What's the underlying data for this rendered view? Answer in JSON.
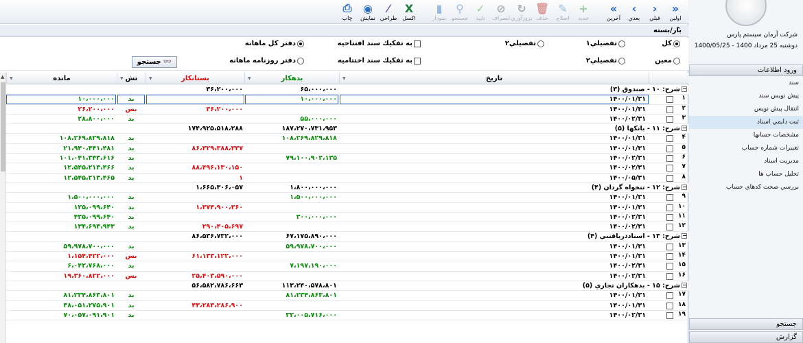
{
  "toolbar": {
    "buttons": [
      {
        "label": "اولين",
        "icon": "double-chevron-right-icon",
        "enabled": true
      },
      {
        "label": "قبلي",
        "icon": "chevron-right-icon",
        "enabled": true
      },
      {
        "label": "بعدي",
        "icon": "chevron-left-icon",
        "enabled": true
      },
      {
        "label": "آخرين",
        "icon": "double-chevron-left-icon",
        "enabled": true
      },
      {
        "label": "جديد",
        "icon": "plus-icon",
        "enabled": false
      },
      {
        "label": "اصلاح",
        "icon": "pencil-icon",
        "enabled": false
      },
      {
        "label": "حذف",
        "icon": "trash-icon",
        "enabled": false
      },
      {
        "label": "بروزآوري",
        "icon": "refresh-icon",
        "enabled": false
      },
      {
        "label": "انصراف",
        "icon": "cancel-icon",
        "enabled": false
      },
      {
        "label": "تاييد",
        "icon": "check-icon",
        "enabled": false
      },
      {
        "label": "جستجو",
        "icon": "magnifier-icon",
        "enabled": false
      },
      {
        "label": "نمودار",
        "icon": "chart-icon",
        "enabled": false
      },
      {
        "label": "اكسل",
        "icon": "excel-icon",
        "enabled": true
      },
      {
        "label": "طراحي",
        "icon": "brush-icon",
        "enabled": true
      },
      {
        "label": "نمايش",
        "icon": "eye-icon",
        "enabled": true
      },
      {
        "label": "چاپ",
        "icon": "printer-icon",
        "enabled": true
      }
    ]
  },
  "panel": {
    "title": "بار/بسته"
  },
  "filters": {
    "scope": [
      {
        "label": "كل",
        "checked": true
      },
      {
        "label": "تفصيلي۱",
        "checked": false
      },
      {
        "label": "تفصيلي۲",
        "checked": false
      },
      {
        "label": "معين",
        "checked": false
      },
      {
        "label": "تفصيلي۲",
        "checked": false
      }
    ],
    "separate_opening": "به تفكيك سند افتتاحيه",
    "separate_closing": "به تفكيك سند اختتاميه",
    "ledger_monthly": "دفتر كل ماهانه",
    "journal_monthly": "دفتر روزنامه ماهانه",
    "search_button": "جستجو"
  },
  "grid": {
    "columns": {
      "date": "تاريخ",
      "debit": "بدهكار",
      "credit": "بستانكار",
      "nature": "تش",
      "balance": "مانده"
    },
    "rows": [
      {
        "type": "group",
        "title": "شرح: ۱۰ - صندوق  (۳)",
        "debit": "۶۵،۰۰۰،۰۰۰",
        "credit": "۳۶،۲۰۰،۰۰۰"
      },
      {
        "type": "row",
        "num": "۱",
        "date": "۱۴۰۰/۰۱/۳۱",
        "debit": "۱۰،۰۰۰،۰۰۰",
        "credit": "",
        "nature": "بد",
        "balance": "۱۰،۰۰۰،۰۰۰",
        "selected": true
      },
      {
        "type": "row",
        "num": "۲",
        "date": "۱۴۰۰/۰۱/۳۱",
        "debit": "",
        "credit": "۳۶،۲۰۰،۰۰۰",
        "nature": "بس",
        "balance": "۲۶،۲۰۰،۰۰۰"
      },
      {
        "type": "row",
        "num": "۳",
        "date": "۱۴۰۰/۰۲/۳۱",
        "debit": "۵۵،۰۰۰،۰۰۰",
        "credit": "",
        "nature": "بد",
        "balance": "۲۸،۸۰۰،۰۰۰"
      },
      {
        "type": "group",
        "title": "شرح: ۱۱ - بانكها  (۵)",
        "debit": "۱۸۷،۲۷۰،۷۳۱،۹۵۳",
        "credit": "۱۷۴،۹۲۵،۵۱۸،۲۸۸"
      },
      {
        "type": "row",
        "num": "۴",
        "date": "۱۴۰۰/۰۱/۳۱",
        "debit": "۱۰۸،۲۶۹،۸۲۹،۸۱۸",
        "credit": "",
        "nature": "بد",
        "balance": "۱۰۸،۲۶۹،۸۲۹،۸۱۸"
      },
      {
        "type": "row",
        "num": "۵",
        "date": "۱۴۰۰/۰۱/۳۱",
        "debit": "",
        "credit": "۸۶،۳۲۹،۳۸۸،۳۳۷",
        "nature": "بد",
        "balance": "۲۱،۹۴۰،۴۴۱،۴۸۱"
      },
      {
        "type": "row",
        "num": "۶",
        "date": "۱۴۰۰/۰۲/۳۱",
        "debit": "۷۹،۱۰۰،۹۰۲،۱۳۵",
        "credit": "",
        "nature": "بد",
        "balance": "۱۰۱،۰۴۱،۳۴۳،۶۱۶"
      },
      {
        "type": "row",
        "num": "۷",
        "date": "۱۴۰۰/۰۲/۳۱",
        "debit": "",
        "credit": "۸۸،۴۹۶،۱۳۰،۱۵۰",
        "nature": "بد",
        "balance": "۱۲،۵۴۵،۲۱۳،۴۶۶"
      },
      {
        "type": "row",
        "num": "۸",
        "date": "۱۴۰۰/۰۵/۳۱",
        "debit": "",
        "credit": "۱",
        "nature": "بد",
        "balance": "۱۲،۵۴۵،۲۱۳،۴۶۵"
      },
      {
        "type": "group",
        "title": "شرح: ۱۲ - تنخواه گردان  (۴)",
        "debit": "۱،۸۰۰،۰۰۰،۰۰۰",
        "credit": "۱،۶۶۵،۳۰۶،۰۵۷"
      },
      {
        "type": "row",
        "num": "۹",
        "date": "۱۴۰۰/۰۱/۳۱",
        "debit": "۱،۵۰۰،۰۰۰،۰۰۰",
        "credit": "",
        "nature": "بد",
        "balance": "۱،۵۰۰،۰۰۰،۰۰۰"
      },
      {
        "type": "row",
        "num": "۱۰",
        "date": "۱۴۰۰/۰۱/۳۱",
        "debit": "",
        "credit": "۱،۳۷۴،۹۰۰،۳۶۰",
        "nature": "بد",
        "balance": "۱۲۵،۰۹۹،۶۴۰"
      },
      {
        "type": "row",
        "num": "۱۱",
        "date": "۱۴۰۰/۰۲/۳۱",
        "debit": "۳۰۰،۰۰۰،۰۰۰",
        "credit": "",
        "nature": "بد",
        "balance": "۴۲۵،۰۹۹،۶۴۰"
      },
      {
        "type": "row",
        "num": "۱۲",
        "date": "۱۴۰۰/۰۲/۳۱",
        "debit": "",
        "credit": "۲۹۰،۴۰۵،۶۹۷",
        "nature": "بد",
        "balance": "۱۳۴،۶۹۳،۹۴۳"
      },
      {
        "type": "group",
        "title": "شرح: ۱۳ - اسنادذرياقتني  (۴)",
        "debit": "۶۷،۱۷۵،۸۹۰،۰۰۰",
        "credit": "۸۶،۵۳۶،۷۳۲،۰۰۰"
      },
      {
        "type": "row",
        "num": "۱۳",
        "date": "۱۴۰۰/۰۱/۳۱",
        "debit": "۵۹،۹۷۸،۷۰۰،۰۰۰",
        "credit": "",
        "nature": "بد",
        "balance": "۵۹،۹۷۸،۷۰۰،۰۰۰"
      },
      {
        "type": "row",
        "num": "۱۴",
        "date": "۱۴۰۰/۰۱/۳۱",
        "debit": "",
        "credit": "۶۱،۱۳۳،۱۲۲،۰۰۰",
        "nature": "بس",
        "balance": "۱،۱۵۴،۴۲۲،۰۰۰"
      },
      {
        "type": "row",
        "num": "۱۵",
        "date": "۱۴۰۰/۰۲/۳۱",
        "debit": "۷،۱۹۷،۱۹۰،۰۰۰",
        "credit": "",
        "nature": "بد",
        "balance": "۶،۰۴۲،۷۶۸،۰۰۰"
      },
      {
        "type": "row",
        "num": "۱۶",
        "date": "۱۴۰۰/۰۲/۳۱",
        "debit": "",
        "credit": "۲۵،۴۰۳،۵۹۰،۰۰۰",
        "nature": "بس",
        "balance": "۱۹،۳۶۰،۸۲۲،۰۰۰"
      },
      {
        "type": "group",
        "title": "شرح: ۱۵ - بدهكاران تجاري  (۵)",
        "debit": "۱۱۳،۲۴۰،۵۷۸،۸۰۱",
        "credit": "۵۶،۵۸۲،۷۸۶،۶۶۳"
      },
      {
        "type": "row",
        "num": "۱۷",
        "date": "۱۴۰۰/۰۱/۳۱",
        "debit": "۸۱،۲۳۴،۸۶۳،۸۰۱",
        "credit": "",
        "nature": "بد",
        "balance": "۸۱،۲۳۴،۸۶۳،۸۰۱"
      },
      {
        "type": "row",
        "num": "۱۸",
        "date": "۱۴۰۰/۰۱/۳۱",
        "debit": "",
        "credit": "۴۳،۲۸۳،۲۸۶،۹۰۰",
        "nature": "بد",
        "balance": "۳۸،۰۵۱،۲۷۵،۹۰۱"
      },
      {
        "type": "row",
        "num": "۱۹",
        "date": "۱۴۰۰/۰۲/۳۱",
        "debit": "۳۲،۰۰۵،۷۱۶،۰۰۰",
        "credit": "",
        "nature": "بد",
        "balance": "۷۰،۰۵۷،۰۹۱،۹۰۱"
      }
    ]
  },
  "sidebar": {
    "company": "شركت آرمان سيستم پارس",
    "date": "دوشنبه 25 مرداد 1400 - 1400/05/25",
    "section": "ورود اطلاعات",
    "items": [
      {
        "label": "سند",
        "active": false
      },
      {
        "label": "پيش نويس سند",
        "active": false
      },
      {
        "label": "انتقال پيش نويس",
        "active": false
      },
      {
        "label": "ثبت دايمي اسناد",
        "active": true
      },
      {
        "label": "مشخصات حسابها",
        "active": false
      },
      {
        "label": "تغييرات شماره حساب",
        "active": false
      },
      {
        "label": "مديريت اسناد",
        "active": false
      },
      {
        "label": "تحليل حساب ها",
        "active": false
      },
      {
        "label": "بررسي صحت كدهاي حساب",
        "active": false
      }
    ],
    "search_section": "جستجو",
    "report_section": "گزارش"
  }
}
